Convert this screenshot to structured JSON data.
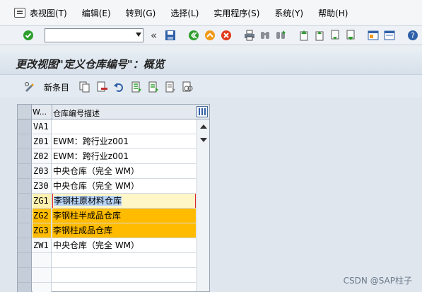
{
  "menu": {
    "items": [
      "表视图(T)",
      "编辑(E)",
      "转到(G)",
      "选择(L)",
      "实用程序(S)",
      "系统(Y)",
      "帮助(H)"
    ]
  },
  "toolbar": {
    "command_value": "",
    "nav_glyph": "«"
  },
  "title": "更改视图\"定义仓库编号\"：概览",
  "app_toolbar": {
    "new_entries_label": "新条目"
  },
  "table": {
    "headers": {
      "key": "W...",
      "desc": "仓库编号描述"
    },
    "rows": [
      {
        "key": "VA1",
        "desc": ""
      },
      {
        "key": "Z01",
        "desc": "EWM：跨行业z001"
      },
      {
        "key": "Z02",
        "desc": "EWM：跨行业z001"
      },
      {
        "key": "Z03",
        "desc": "中央仓库（完全 WM）"
      },
      {
        "key": "Z30",
        "desc": "中央仓库（完全 WM）"
      },
      {
        "key": "ZG1",
        "desc": "李钢柱原材料仓库"
      },
      {
        "key": "ZG2",
        "desc": "李钢柱半成品仓库"
      },
      {
        "key": "ZG3",
        "desc": "李钢柱成品仓库"
      },
      {
        "key": "ZW1",
        "desc": "中央仓库（完全 WM）"
      },
      {
        "key": "",
        "desc": ""
      },
      {
        "key": "",
        "desc": ""
      },
      {
        "key": "",
        "desc": ""
      }
    ],
    "focused_row": 5,
    "selected_rows": [
      6,
      7
    ]
  },
  "watermark": "CSDN @SAP柱子",
  "colors": {
    "selection": "#ffbb00",
    "focus": "#fff6c8",
    "ok_green": "#2e9e2e",
    "cancel_red": "#e03a1a",
    "nav_orange": "#f09a1a"
  }
}
